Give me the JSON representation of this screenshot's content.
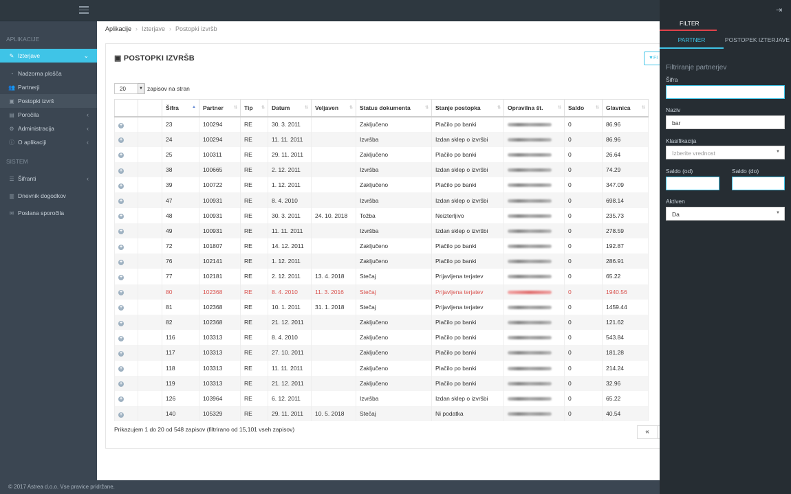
{
  "sidebar": {
    "section_apps": "APLIKACIJE",
    "section_system": "SISTEM",
    "items": [
      {
        "label": "Izterjave",
        "icon": "wrench-icon"
      },
      {
        "label": "Nadzorna plošča",
        "icon": "dashboard-icon"
      },
      {
        "label": "Partnerji",
        "icon": "users-icon"
      },
      {
        "label": "Postopki izvrš",
        "icon": "money-icon"
      },
      {
        "label": "Poročila",
        "icon": "file-icon"
      },
      {
        "label": "Administracija",
        "icon": "gears-icon"
      },
      {
        "label": "O aplikaciji",
        "icon": "info-icon"
      },
      {
        "label": "Šifranti",
        "icon": "list-icon"
      },
      {
        "label": "Dnevnik dogodkov",
        "icon": "book-icon"
      },
      {
        "label": "Poslana sporočila",
        "icon": "envelope-icon"
      }
    ]
  },
  "breadcrumb": [
    "Aplikacije",
    "Izterjave",
    "Postopki izvršb"
  ],
  "page_title": "POSTOPKI IZVRŠB",
  "filter_button": "FI",
  "length": {
    "value": "20",
    "label": "zapisov na stran"
  },
  "table": {
    "columns": [
      "",
      "",
      "Šifra",
      "Partner",
      "Tip",
      "Datum",
      "Veljaven",
      "Status dokumenta",
      "Stanje postopka",
      "Opravilna št.",
      "Saldo",
      "Glavnica"
    ],
    "rows": [
      [
        "23",
        "100294",
        "RE",
        "30. 3. 2011",
        "",
        "Zaključeno",
        "Plačilo po banki",
        "0",
        "86.96"
      ],
      [
        "24",
        "100294",
        "RE",
        "11. 11. 2011",
        "",
        "Izvršba",
        "Izdan sklep o izvršbi",
        "0",
        "86.96"
      ],
      [
        "25",
        "100311",
        "RE",
        "29. 11. 2011",
        "",
        "Zaključeno",
        "Plačilo po banki",
        "0",
        "26.64"
      ],
      [
        "38",
        "100665",
        "RE",
        "2. 12. 2011",
        "",
        "Izvršba",
        "Izdan sklep o izvršbi",
        "0",
        "74.29"
      ],
      [
        "39",
        "100722",
        "RE",
        "1. 12. 2011",
        "",
        "Zaključeno",
        "Plačilo po banki",
        "0",
        "347.09"
      ],
      [
        "47",
        "100931",
        "RE",
        "8. 4. 2010",
        "",
        "Izvršba",
        "Izdan sklep o izvršbi",
        "0",
        "698.14"
      ],
      [
        "48",
        "100931",
        "RE",
        "30. 3. 2011",
        "24. 10. 2018",
        "Tožba",
        "Neizterljivo",
        "0",
        "235.73"
      ],
      [
        "49",
        "100931",
        "RE",
        "11. 11. 2011",
        "",
        "Izvršba",
        "Izdan sklep o izvršbi",
        "0",
        "278.59"
      ],
      [
        "72",
        "101807",
        "RE",
        "14. 12. 2011",
        "",
        "Zaključeno",
        "Plačilo po banki",
        "0",
        "192.87"
      ],
      [
        "76",
        "102141",
        "RE",
        "1. 12. 2011",
        "",
        "Zaključeno",
        "Plačilo po banki",
        "0",
        "286.91"
      ],
      [
        "77",
        "102181",
        "RE",
        "2. 12. 2011",
        "13. 4. 2018",
        "Stečaj",
        "Prijavljena terjatev",
        "0",
        "65.22"
      ],
      [
        "80",
        "102368",
        "RE",
        "8. 4. 2010",
        "11. 3. 2016",
        "Stečaj",
        "Prijavljena terjatev",
        "0",
        "1940.56"
      ],
      [
        "81",
        "102368",
        "RE",
        "10. 1. 2011",
        "31. 1. 2018",
        "Stečaj",
        "Prijavljena terjatev",
        "0",
        "1459.44"
      ],
      [
        "82",
        "102368",
        "RE",
        "21. 12. 2011",
        "",
        "Zaključeno",
        "Plačilo po banki",
        "0",
        "121.62"
      ],
      [
        "116",
        "103313",
        "RE",
        "8. 4. 2010",
        "",
        "Zaključeno",
        "Plačilo po banki",
        "0",
        "543.84"
      ],
      [
        "117",
        "103313",
        "RE",
        "27. 10. 2011",
        "",
        "Zaključeno",
        "Plačilo po banki",
        "0",
        "181.28"
      ],
      [
        "118",
        "103313",
        "RE",
        "11. 11. 2011",
        "",
        "Zaključeno",
        "Plačilo po banki",
        "0",
        "214.24"
      ],
      [
        "119",
        "103313",
        "RE",
        "21. 12. 2011",
        "",
        "Zaključeno",
        "Plačilo po banki",
        "0",
        "32.96"
      ],
      [
        "126",
        "103964",
        "RE",
        "6. 12. 2011",
        "",
        "Izvršba",
        "Izdan sklep o izvršbi",
        "0",
        "65.22"
      ],
      [
        "140",
        "105329",
        "RE",
        "29. 11. 2011",
        "10. 5. 2018",
        "Stečaj",
        "Ni podatka",
        "0",
        "40.54"
      ]
    ],
    "highlight_row": 11
  },
  "info": "Prikazujem 1 do 20 od 548 zapisov (filtrirano od 15,101 vseh zapisov)",
  "pager_prev": "«",
  "footer": "© 2017 Astrea d.o.o. Vse pravice pridržane.",
  "filter_panel": {
    "tab_filter": "FILTER",
    "tab_partner": "PARTNER",
    "tab_postopek": "POSTOPEK IZTERJAVE",
    "heading": "Filtriranje partnerjev",
    "sifra_label": "Šifra",
    "sifra_value": "",
    "naziv_label": "Naziv",
    "naziv_value": "bar",
    "klasifikacija_label": "Klasifikacija",
    "klasifikacija_placeholder": "Izberite vrednost",
    "saldo_od_label": "Saldo (od)",
    "saldo_do_label": "Saldo (do)",
    "aktiven_label": "Aktiven",
    "aktiven_value": "Da"
  },
  "colors": {
    "accent": "#3fc4e7",
    "danger": "#d9534f",
    "tab_active": "#e0424a"
  }
}
